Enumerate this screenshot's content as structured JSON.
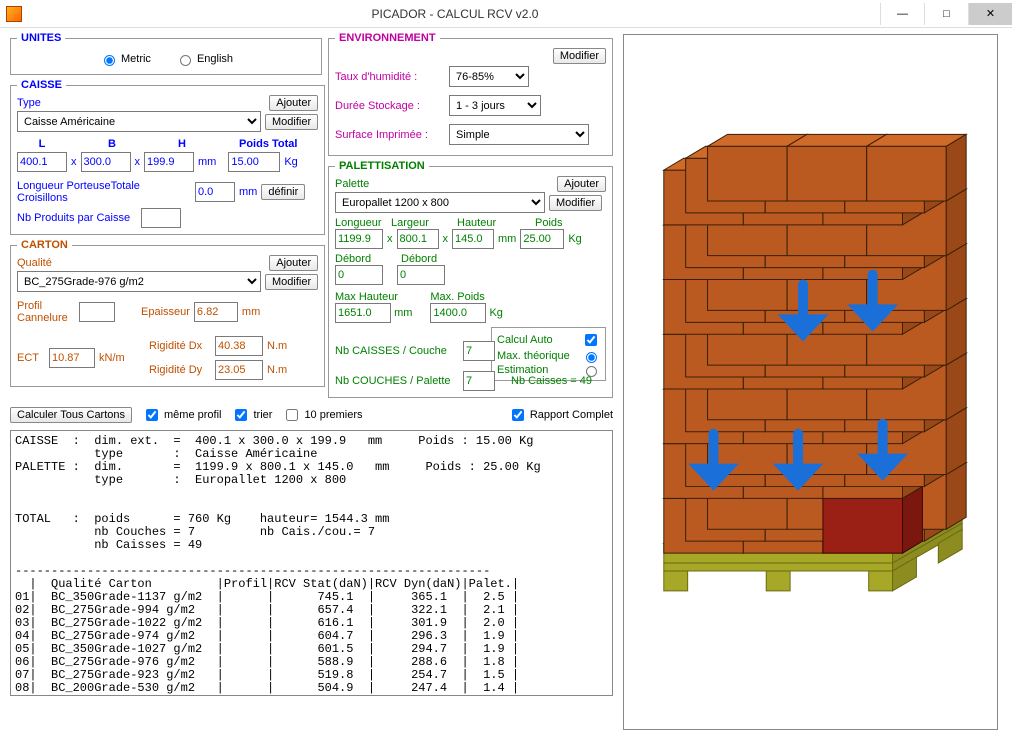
{
  "window": {
    "title": "PICADOR - CALCUL RCV  v2.0",
    "min": "—",
    "max": "□",
    "close": "✕"
  },
  "unites": {
    "legend": "UNITES",
    "metric": "Metric",
    "english": "English"
  },
  "caisse": {
    "legend": "CAISSE",
    "type_label": "Type",
    "type_value": "Caisse Américaine",
    "ajouter": "Ajouter",
    "modifier": "Modifier",
    "L": "L",
    "B": "B",
    "H": "H",
    "poids_total": "Poids Total",
    "L_val": "400.1",
    "B_val": "300.0",
    "H_val": "199.9",
    "mm": "mm",
    "poids_val": "15.00",
    "kg": "Kg",
    "longueur_porteuse": "Longueur PorteuseTotale Croisillons",
    "longueur_val": "0.0",
    "definir": "définir",
    "nb_produits": "Nb Produits par Caisse",
    "nb_produits_val": ""
  },
  "carton": {
    "legend": "CARTON",
    "qualite": "Qualité",
    "qualite_value": "BC_275Grade-976 g/m2",
    "ajouter": "Ajouter",
    "modifier": "Modifier",
    "profil": "Profil Cannelure",
    "profil_val": "",
    "epaisseur": "Epaisseur",
    "epaisseur_val": "6.82",
    "mm": "mm",
    "ect": "ECT",
    "ect_val": "10.87",
    "knm": "kN/m",
    "rigidite_dx": "Rigidité Dx",
    "rdx_val": "40.38",
    "rigidite_dy": "Rigidité Dy",
    "rdy_val": "23.05",
    "nm": "N.m"
  },
  "env": {
    "legend": "ENVIRONNEMENT",
    "taux": "Taux d'humidité :",
    "taux_val": "76-85%",
    "duree": "Durée Stockage :",
    "duree_val": "1 - 3 jours",
    "surface": "Surface Imprimée :",
    "surface_val": "Simple",
    "modifier": "Modifier"
  },
  "palet": {
    "legend": "PALETTISATION",
    "palette": "Palette",
    "palette_val": "Europallet 1200 x 800",
    "ajouter": "Ajouter",
    "modifier": "Modifier",
    "longueur": "Longueur",
    "largeur": "Largeur",
    "hauteur": "Hauteur",
    "poids": "Poids",
    "L_val": "1199.9",
    "l_val": "800.1",
    "h_val": "145.0",
    "mm": "mm",
    "p_val": "25.00",
    "kg": "Kg",
    "debord1": "Débord",
    "debord2": "Débord",
    "d1_val": "0",
    "d2_val": "0",
    "max_hauteur": "Max Hauteur",
    "maxh_val": "1651.0",
    "max_poids": "Max. Poids",
    "maxp_val": "1400.0",
    "calcul_auto": "Calcul Auto",
    "max_theo": "Max. théorique",
    "estimation": "Estimation",
    "nb_caisses_couche": "Nb CAISSES / Couche",
    "ncc_val": "7",
    "nb_couches_palette": "Nb COUCHES / Palette",
    "ncp_val": "7",
    "nb_caisses": "Nb Caisses  =  49"
  },
  "ctrlbar": {
    "calc": "Calculer Tous Cartons",
    "meme_profil": "même profil",
    "trier": "trier",
    "dix_premiers": "10 premiers",
    "rapport": "Rapport Complet"
  },
  "terminal": "CAISSE  :  dim. ext.  =  400.1 x 300.0 x 199.9   mm     Poids : 15.00 Kg\n           type       :  Caisse Américaine\nPALETTE :  dim.       =  1199.9 x 800.1 x 145.0   mm     Poids : 25.00 Kg\n           type       :  Europallet 1200 x 800\n\n\nTOTAL   :  poids      = 760 Kg    hauteur= 1544.3 mm\n           nb Couches = 7         nb Cais./cou.= 7\n           nb Caisses = 49\n\n------------------------------------------------------------------\n  |  Qualité Carton         |Profil|RCV Stat(daN)|RCV Dyn(daN)|Palet.|\n01|  BC_350Grade-1137 g/m2  |      |      745.1  |     365.1  |  2.5 |\n02|  BC_275Grade-994 g/m2   |      |      657.4  |     322.1  |  2.1 |\n03|  BC_275Grade-1022 g/m2  |      |      616.1  |     301.9  |  2.0 |\n04|  BC_275Grade-974 g/m2   |      |      604.7  |     296.3  |  1.9 |\n05|  BC_350Grade-1027 g/m2  |      |      601.5  |     294.7  |  1.9 |\n06|  BC_275Grade-976 g/m2   |      |      588.9  |     288.6  |  1.8 |\n07|  BC_275Grade-923 g/m2   |      |      519.8  |     254.7  |  1.5 |\n08|  BC_200Grade-530 g/m2   |      |      504.9  |     247.4  |  1.4 |"
}
